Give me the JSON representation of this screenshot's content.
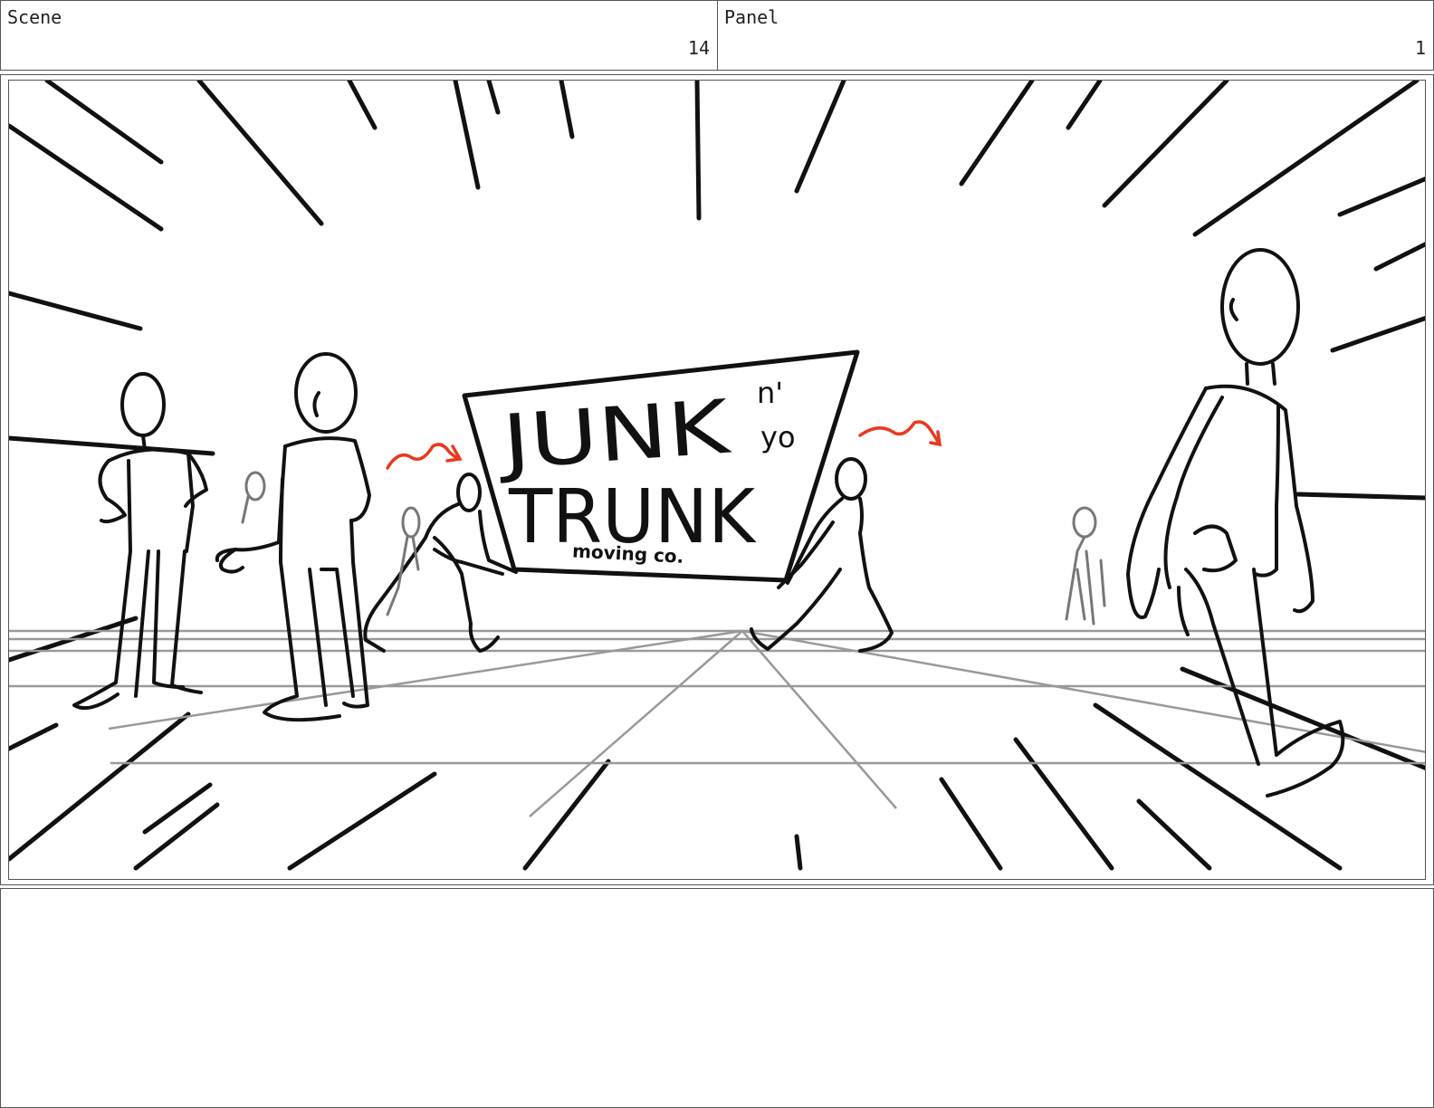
{
  "header": {
    "scene_label": "Scene",
    "scene_number": "14",
    "panel_label": "Panel",
    "panel_number": "1"
  },
  "sign": {
    "line1": "JUNK",
    "line2": "TRUNK",
    "tag_n": "n'",
    "tag_yo": "yo",
    "subtitle": "moving co."
  },
  "colors": {
    "ink": "#111111",
    "guide": "#999999",
    "motion": "#e8391f"
  },
  "notes": {
    "text": ""
  }
}
